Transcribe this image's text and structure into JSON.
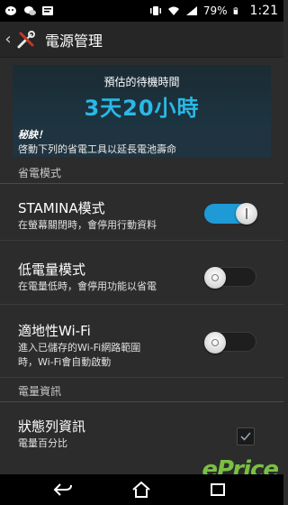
{
  "statusbar": {
    "battery_percent": "79%",
    "clock": "1:21",
    "icons": [
      "wechat-icon",
      "message-icon",
      "notification-icon",
      "vibrate-icon",
      "wifi-icon",
      "signal-icon",
      "battery-icon"
    ]
  },
  "actionbar": {
    "title": "電源管理",
    "back_icon": "chevron-left-icon",
    "app_icon": "tools-icon"
  },
  "standby": {
    "label": "預估的待機時間",
    "time": "3天20小時",
    "tip_title": "秘訣！",
    "tip_body": "啓動下列的省電工具以延長電池壽命"
  },
  "sections": {
    "power_saving_header": "省電模式",
    "battery_info_header": "電量資訊"
  },
  "settings": [
    {
      "title": "STAMINA模式",
      "subtitle": "在螢幕關閉時，會停用行動資料",
      "state": "on"
    },
    {
      "title": "低電量模式",
      "subtitle": "在電量低時，會停用功能以省電",
      "state": "off"
    },
    {
      "title": "適地性Wi-Fi",
      "subtitle_line1": "進入已儲存的Wi-Fi網路範圍",
      "subtitle_line2": "時，Wi-Fi會自動啟動",
      "state": "off"
    }
  ],
  "battery_info": {
    "title": "狀態列資訊",
    "subtitle": "電量百分比",
    "checked": true
  },
  "watermark": "ePrice",
  "colors": {
    "accent": "#1e9ad6",
    "standby_time": "#2ab8e8",
    "background": "#2c2c2c"
  }
}
